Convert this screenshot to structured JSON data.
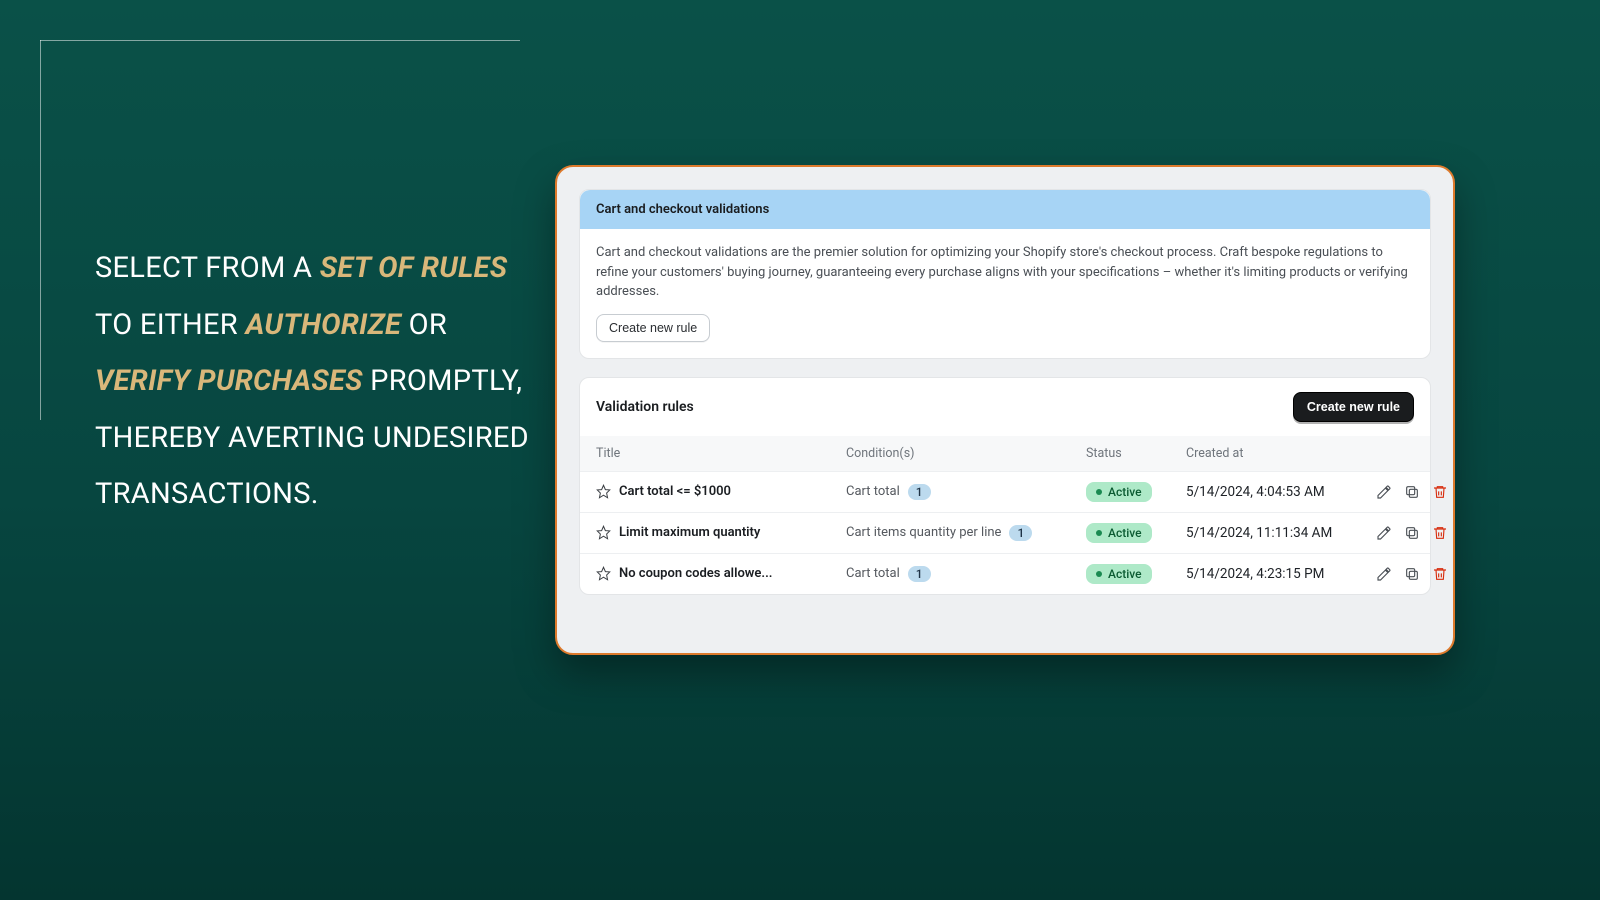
{
  "marketing": {
    "seg1": "Select from a ",
    "em1": "set of rules",
    "seg2": " to either ",
    "em2": "authorize",
    "seg3": " or ",
    "em3": "verify purchases",
    "seg4": " promptly, thereby averting undesired transactions."
  },
  "top_card": {
    "title": "Cart and checkout validations",
    "description": "Cart and checkout validations are the premier solution for optimizing your Shopify store's checkout process. Craft bespoke regulations to refine your customers' buying journey, guaranteeing every purchase aligns with your specifications – whether it's limiting products or verifying addresses.",
    "create_label": "Create new rule"
  },
  "rules": {
    "section_title": "Validation rules",
    "create_label": "Create new rule",
    "columns": {
      "title": "Title",
      "conditions": "Condition(s)",
      "status": "Status",
      "created": "Created at"
    },
    "items": [
      {
        "title": "Cart total <= $1000",
        "condition": "Cart total",
        "count": "1",
        "status": "Active",
        "created": "5/14/2024, 4:04:53 AM"
      },
      {
        "title": "Limit maximum quantity",
        "condition": "Cart items quantity per line",
        "count": "1",
        "status": "Active",
        "created": "5/14/2024, 11:11:34 AM"
      },
      {
        "title": "No coupon codes allowe...",
        "condition": "Cart total",
        "count": "1",
        "status": "Active",
        "created": "5/14/2024, 4:23:15 PM"
      }
    ]
  }
}
